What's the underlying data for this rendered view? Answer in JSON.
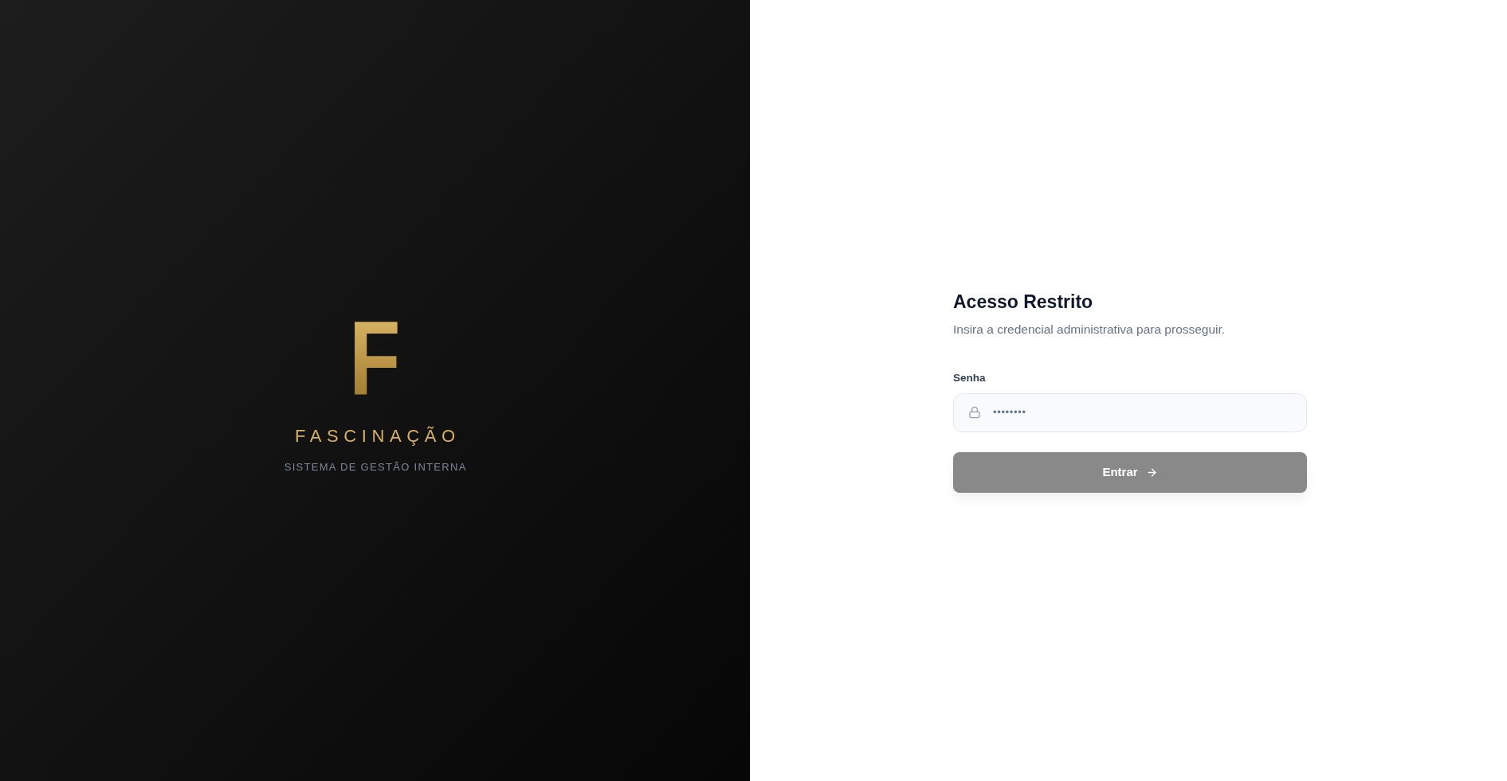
{
  "brand": {
    "logo_letter": "F",
    "name": "FASCINAÇÃO",
    "tagline": "SISTEMA DE GESTÃO INTERNA"
  },
  "login": {
    "title": "Acesso Restrito",
    "subtitle": "Insira a credencial administrativa para prosseguir.",
    "password": {
      "label": "Senha",
      "value": "••••••••"
    },
    "submit": {
      "label": "Entrar",
      "disabled": true
    }
  }
}
